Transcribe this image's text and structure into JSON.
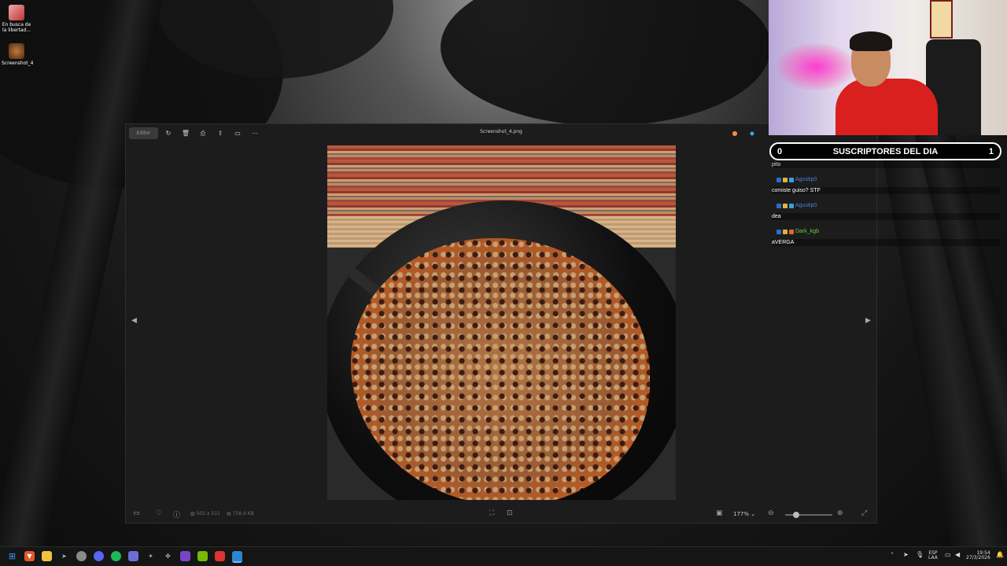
{
  "desktop": {
    "icons": [
      {
        "label": "En busca de la libertad...",
        "icon": "game-shortcut-icon"
      },
      {
        "label": "Screenshot_4",
        "icon": "image-file-icon"
      }
    ]
  },
  "photos_app": {
    "title": "Screenshot_4.png",
    "toolbar": {
      "editor_label": "Editor",
      "icons": [
        "rotate-icon",
        "delete-icon",
        "print-icon",
        "share-icon",
        "slideshow-icon",
        "more-icon"
      ],
      "right_icons": [
        "copilot-icon",
        "photos-app-icon"
      ]
    },
    "image_description": "photo-of-rice-and-lentils-in-black-bowl",
    "bottom_bar": {
      "dimensions": "502 x 511",
      "file_size": "758.9 KB",
      "zoom": "177%"
    }
  },
  "overlay": {
    "subs_left": "0",
    "subs_title": "SUSCRIPTORES DEL DIA",
    "subs_right": "1"
  },
  "chat": [
    {
      "user": "",
      "text": "pito"
    },
    {
      "user": "Agustip0",
      "text": "comiste guiso? STF",
      "color": "#4f7fd9"
    },
    {
      "user": "Agustip0",
      "text": "dea",
      "color": "#4f7fd9"
    },
    {
      "user": "Dark_kgb",
      "text": "aVERGA",
      "color": "#5fd33a"
    }
  ],
  "taskbar": {
    "icons": [
      "start-icon",
      "brave-icon",
      "file-explorer-icon",
      "steam-icon",
      "discord-icon",
      "chrome-icon",
      "spotify-icon",
      "app-icon",
      "app-icon-2",
      "app-icon-3",
      "nvidia-icon",
      "app-icon-4",
      "photos-icon"
    ],
    "lang_top": "ESP",
    "lang_bottom": "LAA",
    "time": "19:54",
    "date": "27/3/2026"
  }
}
